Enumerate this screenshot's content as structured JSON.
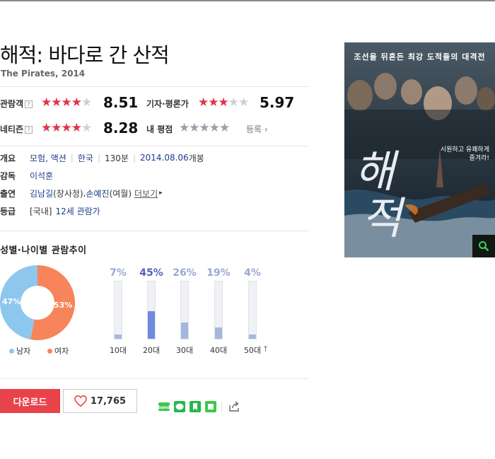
{
  "movie": {
    "title": "해적: 바다로 간 산적",
    "subtitle": "The Pirates, 2014"
  },
  "ratings": {
    "audience": {
      "label": "관람객",
      "help": "?",
      "score": "8.51",
      "stars": 4.25
    },
    "critic": {
      "label": "기자·평론가",
      "score": "5.97",
      "stars": 3.0
    },
    "netizen": {
      "label": "네티즌",
      "help": "?",
      "score": "8.28",
      "stars": 4.14
    },
    "mine": {
      "label": "내 평점",
      "action": "등록",
      "stars": 0
    }
  },
  "info": {
    "overview_label": "개요",
    "genre": "모험, 액션",
    "country": "한국",
    "runtime": "130분",
    "release": "2014.08.06",
    "release_suffix": "개봉",
    "director_label": "감독",
    "director": "이석훈",
    "cast_label": "출연",
    "cast_1": "김남길",
    "cast_1_role": "(장사정)",
    "cast_comma": ", ",
    "cast_2": "손예진",
    "cast_2_role": "(여월)",
    "cast_more": "더보기",
    "grade_label": "등급",
    "grade_prefix": "[국내]",
    "grade": "12세 관람가"
  },
  "demographics": {
    "section_title": "성별·나이별 관람추이",
    "male_label": "남자",
    "female_label": "여자",
    "male_pct_label": "47%",
    "female_pct_label": "53%"
  },
  "chart_data": [
    {
      "type": "pie",
      "title": "",
      "categories": [
        "남자",
        "여자"
      ],
      "values": [
        47,
        53
      ],
      "colors": [
        "#8ec7ee",
        "#f7845b"
      ]
    },
    {
      "type": "bar",
      "title": "",
      "categories": [
        "10대",
        "20대",
        "30대",
        "40대",
        "50대"
      ],
      "values": [
        7,
        45,
        26,
        19,
        4
      ],
      "value_labels": [
        "7%",
        "45%",
        "26%",
        "19%",
        "4%"
      ],
      "highlight_index": 1,
      "ylim": [
        0,
        100
      ],
      "colors": {
        "normal": "#a5b7de",
        "highlight": "#6f8be0",
        "pct_text": "#9aa8d3",
        "pct_highlight": "#5060b8"
      }
    }
  ],
  "actions": {
    "download_label": "다운로드",
    "like_count": "17,765"
  },
  "poster": {
    "caption": "조선을 뒤흔든 최강 도적들의 대격전",
    "side_text_1": "시원하고 유쾌하게",
    "side_text_2": "즐겨라!",
    "big_text_1": "해",
    "big_text_2": "적"
  },
  "colors": {
    "accent_red": "#e0344a",
    "download_bg": "#e8424b",
    "link_blue": "#1b3f8a"
  }
}
